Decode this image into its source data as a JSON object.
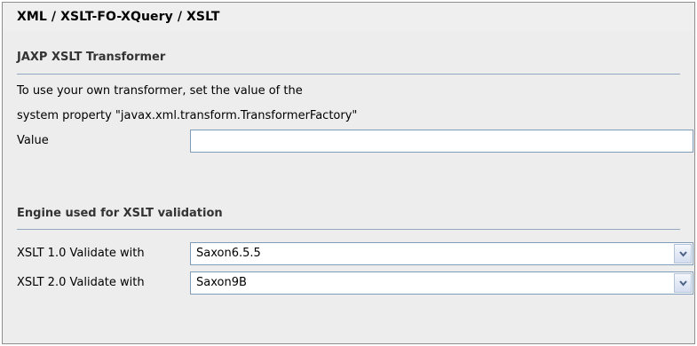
{
  "header": {
    "title": "XML / XSLT-FO-XQuery / XSLT"
  },
  "jaxp": {
    "heading": "JAXP XSLT Transformer",
    "description_line1": "To use your own transformer, set the value of the",
    "description_line2": "system property \"javax.xml.transform.TransformerFactory\"",
    "value_label": "Value",
    "value": ""
  },
  "engine": {
    "heading": "Engine used for XSLT validation",
    "xslt10_label": "XSLT 1.0 Validate with",
    "xslt10_value": "Saxon6.5.5",
    "xslt20_label": "XSLT 2.0 Validate with",
    "xslt20_value": "Saxon9B"
  },
  "icons": {
    "dropdown": "chevron-down-icon"
  }
}
